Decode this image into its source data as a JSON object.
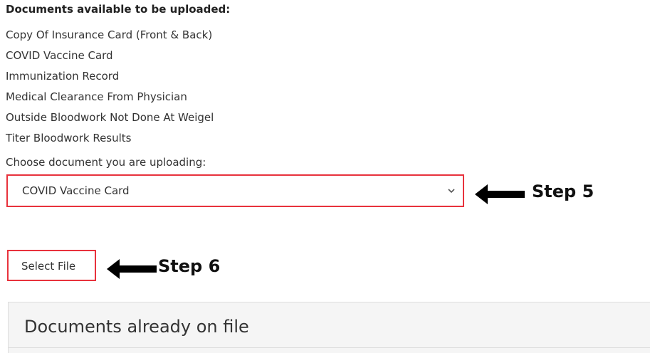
{
  "upload_section": {
    "heading": "Documents available to be uploaded:",
    "available_documents": [
      "Copy Of Insurance Card (Front & Back)",
      "COVID Vaccine Card",
      "Immunization Record",
      "Medical Clearance From Physician",
      "Outside Bloodwork Not Done At Weigel",
      "Titer Bloodwork Results"
    ],
    "choose_label": "Choose document you are uploading:",
    "selected_document": "COVID Vaccine Card",
    "select_file_label": "Select File"
  },
  "annotations": {
    "step5": "Step 5",
    "step6": "Step 6",
    "highlight_color": "#e8323c"
  },
  "on_file_panel": {
    "title": "Documents already on file"
  }
}
